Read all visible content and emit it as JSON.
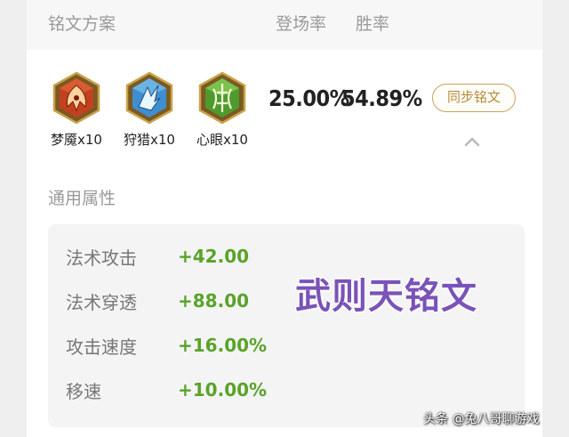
{
  "header": {
    "title": "铭文方案",
    "pick_rate_label": "登场率",
    "win_rate_label": "胜率"
  },
  "runes": [
    {
      "name": "梦魇x10",
      "icon": "red-rune-icon",
      "color": "#c2411f"
    },
    {
      "name": "狩猎x10",
      "icon": "blue-rune-icon",
      "color": "#3f8ecf"
    },
    {
      "name": "心眼x10",
      "icon": "green-rune-icon",
      "color": "#4f9a2e"
    }
  ],
  "stats": {
    "pick_rate": "25.00%",
    "win_rate": "54.89%"
  },
  "sync_button": {
    "label": "同步铭文"
  },
  "collapse_icon": "chevron-up-icon",
  "attributes": {
    "title": "通用属性",
    "items": [
      {
        "name": "法术攻击",
        "value": "+42.00"
      },
      {
        "name": "法术穿透",
        "value": "+88.00"
      },
      {
        "name": "攻击速度",
        "value": "+16.00%"
      },
      {
        "name": "移速",
        "value": "+10.00%"
      }
    ]
  },
  "overlay_text": "武则天铭文",
  "watermark": "头条 @兔八哥聊游戏",
  "colors": {
    "accent_gold": "#c8a45e",
    "value_green": "#5aa32a",
    "overlay_purple": "#7a53b8"
  }
}
